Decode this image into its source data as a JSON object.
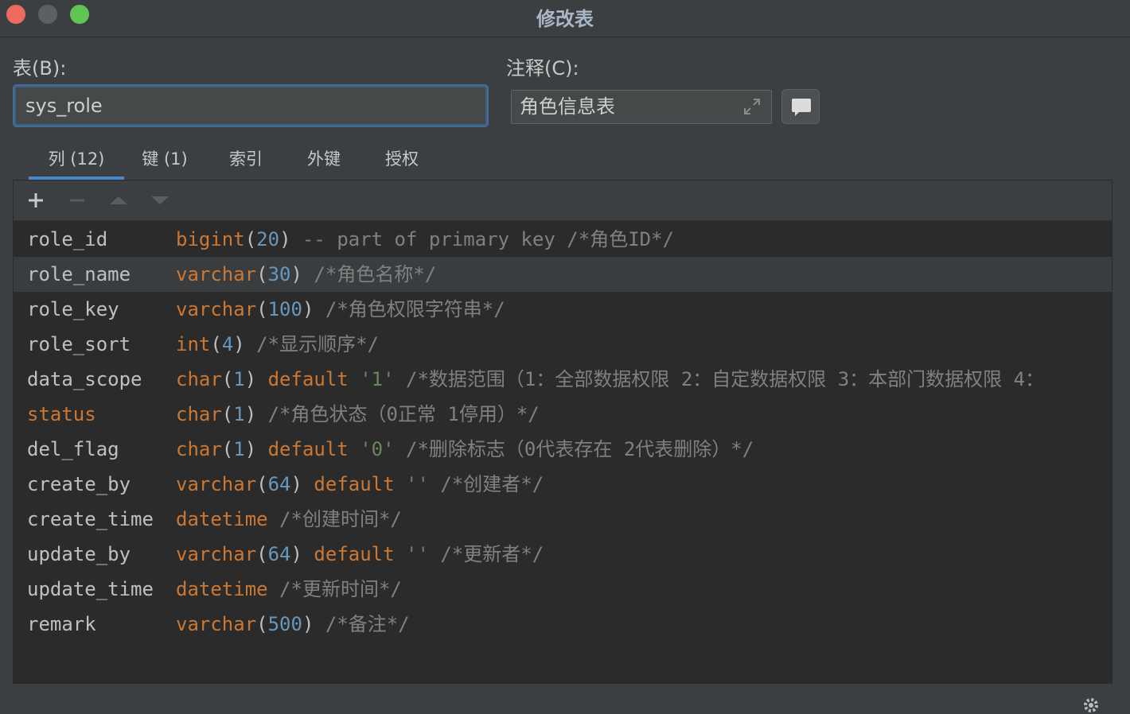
{
  "window": {
    "title": "修改表"
  },
  "form": {
    "table_label": "表(B):",
    "table_value": "sys_role",
    "comment_label": "注释(C):",
    "comment_value": "角色信息表"
  },
  "tabs": [
    {
      "label": "列 (12)",
      "active": true
    },
    {
      "label": "键 (1)"
    },
    {
      "label": "索引"
    },
    {
      "label": "外键"
    },
    {
      "label": "授权"
    }
  ],
  "toolbar": {
    "icons": [
      "add-icon",
      "remove-icon",
      "move-up-icon",
      "move-down-icon"
    ]
  },
  "columns": [
    {
      "name": "role_id",
      "type": "bigint",
      "len": "20",
      "extra": " -- part of primary key",
      "comment": "/*角色ID*/"
    },
    {
      "name": "role_name",
      "type": "varchar",
      "len": "30",
      "comment": "/*角色名称*/"
    },
    {
      "name": "role_key",
      "type": "varchar",
      "len": "100",
      "comment": "/*角色权限字符串*/"
    },
    {
      "name": "role_sort",
      "type": "int",
      "len": "4",
      "comment": "/*显示顺序*/"
    },
    {
      "name": "data_scope",
      "type": "char",
      "len": "1",
      "default": "'1'",
      "comment": "/*数据范围（1：全部数据权限 2：自定数据权限 3：本部门数据权限 4："
    },
    {
      "name": "status",
      "type": "char",
      "len": "1",
      "comment": "/*角色状态（0正常 1停用）*/"
    },
    {
      "name": "del_flag",
      "type": "char",
      "len": "1",
      "default": "'0'",
      "comment": "/*删除标志（0代表存在 2代表删除）*/"
    },
    {
      "name": "create_by",
      "type": "varchar",
      "len": "64",
      "default": "''",
      "comment": "/*创建者*/"
    },
    {
      "name": "create_time",
      "type": "datetime",
      "comment": "/*创建时间*/"
    },
    {
      "name": "update_by",
      "type": "varchar",
      "len": "64",
      "default": "''",
      "comment": "/*更新者*/"
    },
    {
      "name": "update_time",
      "type": "datetime",
      "comment": "/*更新时间*/"
    },
    {
      "name": "remark",
      "type": "varchar",
      "len": "500",
      "comment": "/*备注*/"
    }
  ],
  "selected_row": 1,
  "colors": {
    "keyword": "#cc7832",
    "number": "#6897bb",
    "string": "#6a8759",
    "comment": "#808080",
    "accent": "#4a88c7"
  }
}
